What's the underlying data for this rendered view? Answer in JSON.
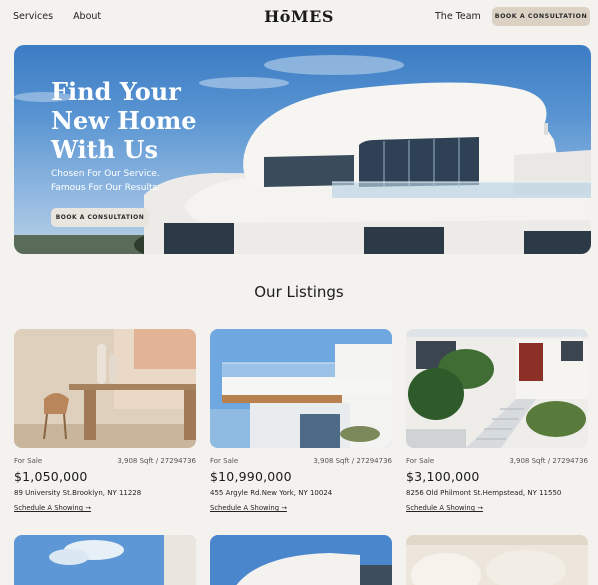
{
  "nav": {
    "services": "Services",
    "about": "About",
    "logo": "HōMES",
    "team": "The Team",
    "cta": "BOOK A CONSULTATION"
  },
  "hero": {
    "title": "Find Your\nNew Home\nWith Us",
    "subtitle": "Chosen For Our Service.\nFamous For Our Results.",
    "cta": "BOOK A CONSULTATION"
  },
  "listings": {
    "title": "Our Listings",
    "items": [
      {
        "status": "For Sale",
        "specs": "3,908 Sqft / 27294736",
        "price": "$1,050,000",
        "address": "89 University St.Brooklyn, NY 11228",
        "link": "Schedule A Showing →"
      },
      {
        "status": "For Sale",
        "specs": "3,908 Sqft / 27294736",
        "price": "$10,990,000",
        "address": "455 Argyle Rd.New York, NY 10024",
        "link": "Schedule A Showing →"
      },
      {
        "status": "For Sale",
        "specs": "3,908 Sqft / 27294736",
        "price": "$3,100,000",
        "address": "8256 Old Philmont St.Hempstead, NY 11550",
        "link": "Schedule A Showing →"
      }
    ]
  },
  "colors": {
    "background": "#f4f2ee",
    "cta_bg": "#dcd2c4",
    "sky": "#4f8cd0"
  }
}
